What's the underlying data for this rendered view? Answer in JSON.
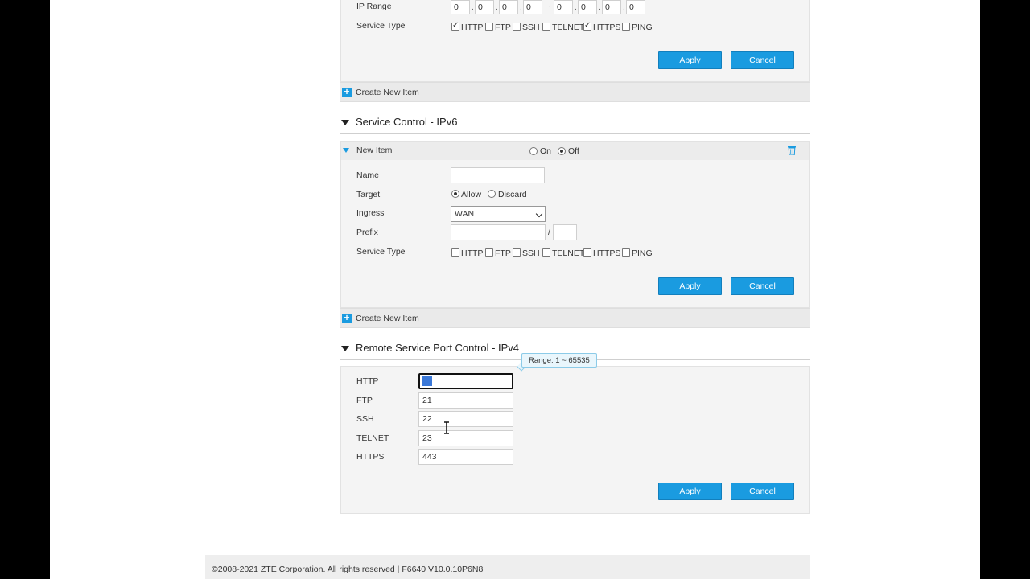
{
  "ipv4_service": {
    "ip_range_label": "IP Range",
    "ip_start": [
      "0",
      "0",
      "0",
      "0"
    ],
    "ip_separator": "~",
    "ip_end": [
      "0",
      "0",
      "0",
      "0"
    ],
    "service_type_label": "Service Type",
    "services": [
      {
        "label": "HTTP",
        "checked": true
      },
      {
        "label": "FTP",
        "checked": false
      },
      {
        "label": "SSH",
        "checked": false
      },
      {
        "label": "TELNET",
        "checked": false
      },
      {
        "label": "HTTPS",
        "checked": true
      },
      {
        "label": "PING",
        "checked": false
      }
    ],
    "apply_label": "Apply",
    "cancel_label": "Cancel",
    "create_new_label": "Create New Item"
  },
  "ipv6_service": {
    "section_title": "Service Control - IPv6",
    "item_title": "New Item",
    "on_label": "On",
    "off_label": "Off",
    "enabled": "Off",
    "name_label": "Name",
    "name_value": "",
    "target_label": "Target",
    "allow_label": "Allow",
    "discard_label": "Discard",
    "target_value": "Allow",
    "ingress_label": "Ingress",
    "ingress_value": "WAN",
    "prefix_label": "Prefix",
    "prefix_value": "",
    "prefix_separator": "/",
    "prefix_length": "",
    "service_type_label": "Service Type",
    "services": [
      {
        "label": "HTTP",
        "checked": false
      },
      {
        "label": "FTP",
        "checked": false
      },
      {
        "label": "SSH",
        "checked": false
      },
      {
        "label": "TELNET",
        "checked": false
      },
      {
        "label": "HTTPS",
        "checked": false
      },
      {
        "label": "PING",
        "checked": false
      }
    ],
    "apply_label": "Apply",
    "cancel_label": "Cancel",
    "create_new_label": "Create New Item"
  },
  "port_control": {
    "section_title": "Remote Service Port Control - IPv4",
    "tooltip": "Range: 1 ~ 65535",
    "ports": [
      {
        "label": "HTTP",
        "value": "80"
      },
      {
        "label": "FTP",
        "value": "21"
      },
      {
        "label": "SSH",
        "value": "22"
      },
      {
        "label": "TELNET",
        "value": "23"
      },
      {
        "label": "HTTPS",
        "value": "443"
      }
    ],
    "apply_label": "Apply",
    "cancel_label": "Cancel"
  },
  "footer": {
    "copyright": "©2008-2021 ZTE Corporation. All rights reserved  |   F6640 V10.0.10P6N8"
  },
  "colors": {
    "accent": "#1a9be0",
    "panel_bg": "#f4f4f4"
  }
}
